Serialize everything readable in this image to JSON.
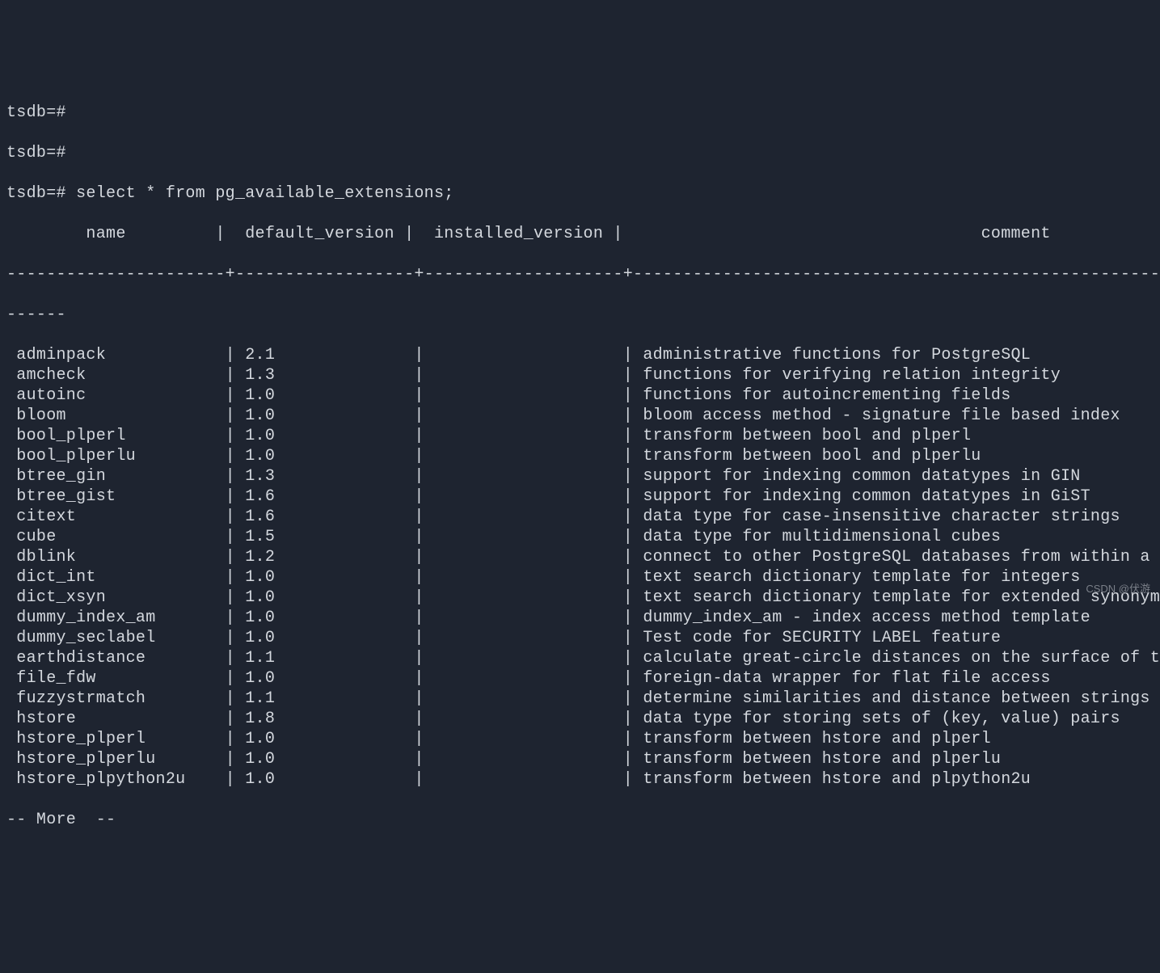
{
  "prompts": [
    "tsdb=#",
    "tsdb=#",
    "tsdb=# select * from pg_available_extensions;"
  ],
  "headers": {
    "name": "name",
    "default_version": "default_version",
    "installed_version": "installed_version",
    "comment": "comment"
  },
  "chart_data": {
    "type": "table",
    "columns": [
      "name",
      "default_version",
      "installed_version",
      "comment"
    ],
    "rows": [
      {
        "name": "adminpack",
        "default_version": "2.1",
        "installed_version": "",
        "comment": "administrative functions for PostgreSQL"
      },
      {
        "name": "amcheck",
        "default_version": "1.3",
        "installed_version": "",
        "comment": "functions for verifying relation integrity"
      },
      {
        "name": "autoinc",
        "default_version": "1.0",
        "installed_version": "",
        "comment": "functions for autoincrementing fields"
      },
      {
        "name": "bloom",
        "default_version": "1.0",
        "installed_version": "",
        "comment": "bloom access method - signature file based index"
      },
      {
        "name": "bool_plperl",
        "default_version": "1.0",
        "installed_version": "",
        "comment": "transform between bool and plperl"
      },
      {
        "name": "bool_plperlu",
        "default_version": "1.0",
        "installed_version": "",
        "comment": "transform between bool and plperlu"
      },
      {
        "name": "btree_gin",
        "default_version": "1.3",
        "installed_version": "",
        "comment": "support for indexing common datatypes in GIN"
      },
      {
        "name": "btree_gist",
        "default_version": "1.6",
        "installed_version": "",
        "comment": "support for indexing common datatypes in GiST"
      },
      {
        "name": "citext",
        "default_version": "1.6",
        "installed_version": "",
        "comment": "data type for case-insensitive character strings"
      },
      {
        "name": "cube",
        "default_version": "1.5",
        "installed_version": "",
        "comment": "data type for multidimensional cubes"
      },
      {
        "name": "dblink",
        "default_version": "1.2",
        "installed_version": "",
        "comment": "connect to other PostgreSQL databases from within a da"
      },
      {
        "name": "dict_int",
        "default_version": "1.0",
        "installed_version": "",
        "comment": "text search dictionary template for integers"
      },
      {
        "name": "dict_xsyn",
        "default_version": "1.0",
        "installed_version": "",
        "comment": "text search dictionary template for extended synonym p"
      },
      {
        "name": "dummy_index_am",
        "default_version": "1.0",
        "installed_version": "",
        "comment": "dummy_index_am - index access method template"
      },
      {
        "name": "dummy_seclabel",
        "default_version": "1.0",
        "installed_version": "",
        "comment": "Test code for SECURITY LABEL feature"
      },
      {
        "name": "earthdistance",
        "default_version": "1.1",
        "installed_version": "",
        "comment": "calculate great-circle distances on the surface of the"
      },
      {
        "name": "file_fdw",
        "default_version": "1.0",
        "installed_version": "",
        "comment": "foreign-data wrapper for flat file access"
      },
      {
        "name": "fuzzystrmatch",
        "default_version": "1.1",
        "installed_version": "",
        "comment": "determine similarities and distance between strings"
      },
      {
        "name": "hstore",
        "default_version": "1.8",
        "installed_version": "",
        "comment": "data type for storing sets of (key, value) pairs"
      },
      {
        "name": "hstore_plperl",
        "default_version": "1.0",
        "installed_version": "",
        "comment": "transform between hstore and plperl"
      },
      {
        "name": "hstore_plperlu",
        "default_version": "1.0",
        "installed_version": "",
        "comment": "transform between hstore and plperlu"
      },
      {
        "name": "hstore_plpython2u",
        "default_version": "1.0",
        "installed_version": "",
        "comment": "transform between hstore and plpython2u"
      }
    ]
  },
  "more_prompt": "-- More  --",
  "watermark": "CSDN @伏游",
  "col_widths": {
    "name": 21,
    "default_version": 17,
    "installed_version": 19
  }
}
